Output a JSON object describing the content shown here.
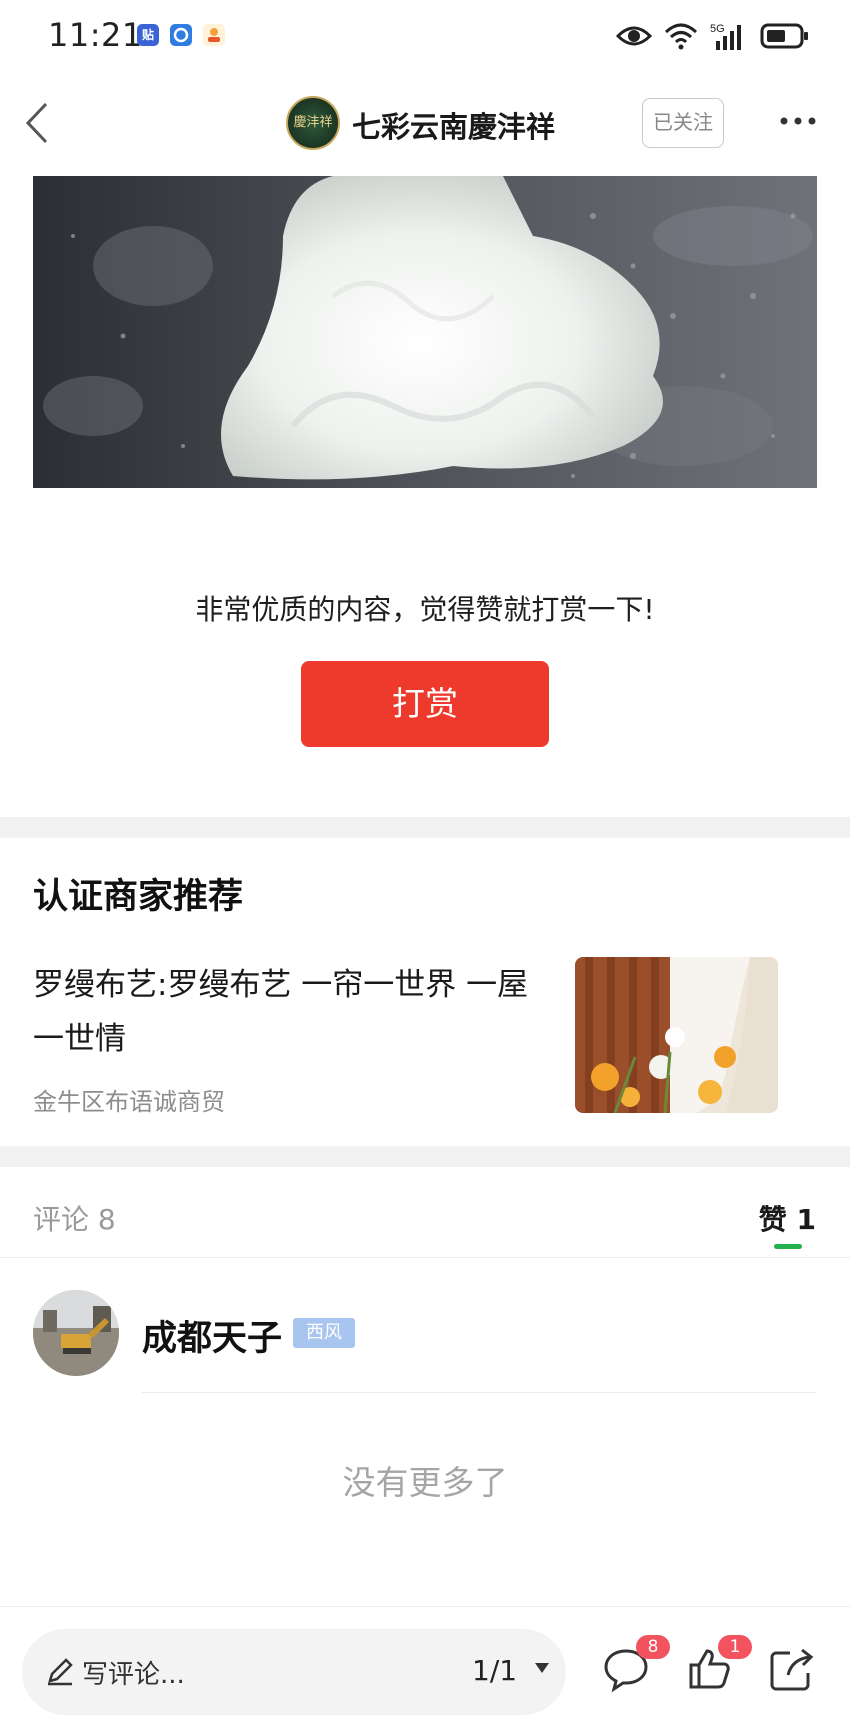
{
  "status_bar": {
    "time": "11:21",
    "app_icons": [
      "tieba-icon",
      "blue-app-icon",
      "yellow-app-icon"
    ],
    "right_icons": [
      "eye-icon",
      "wifi-icon",
      "signal-5g-icon",
      "battery-icon"
    ],
    "network_label": "5G"
  },
  "nav": {
    "account_name": "七彩云南慶沣祥",
    "avatar_text": "慶沣祥",
    "follow_label": "已关注"
  },
  "tip": {
    "text": "非常优质的内容，觉得赞就打赏一下!",
    "button_label": "打赏"
  },
  "merchant_section": {
    "title": "认证商家推荐",
    "item": {
      "title": "罗缦布艺:罗缦布艺 一帘一世界 一屋一世情",
      "subtitle": "金牛区布语诚商贸"
    }
  },
  "comments": {
    "tab_comments": "评论 8",
    "tab_likes": "赞 1"
  },
  "liker": {
    "name": "成都天子",
    "badge": "西风"
  },
  "end_text": "没有更多了",
  "bottom_bar": {
    "comment_placeholder": "写评论...",
    "page_indicator": "1/1",
    "comment_badge": "8",
    "like_badge": "1"
  },
  "colors": {
    "tip_button": "#ee3a2c",
    "tab_indicator": "#22b14c",
    "badge": "#f2535f",
    "user_badge": "#a8c5f0"
  }
}
